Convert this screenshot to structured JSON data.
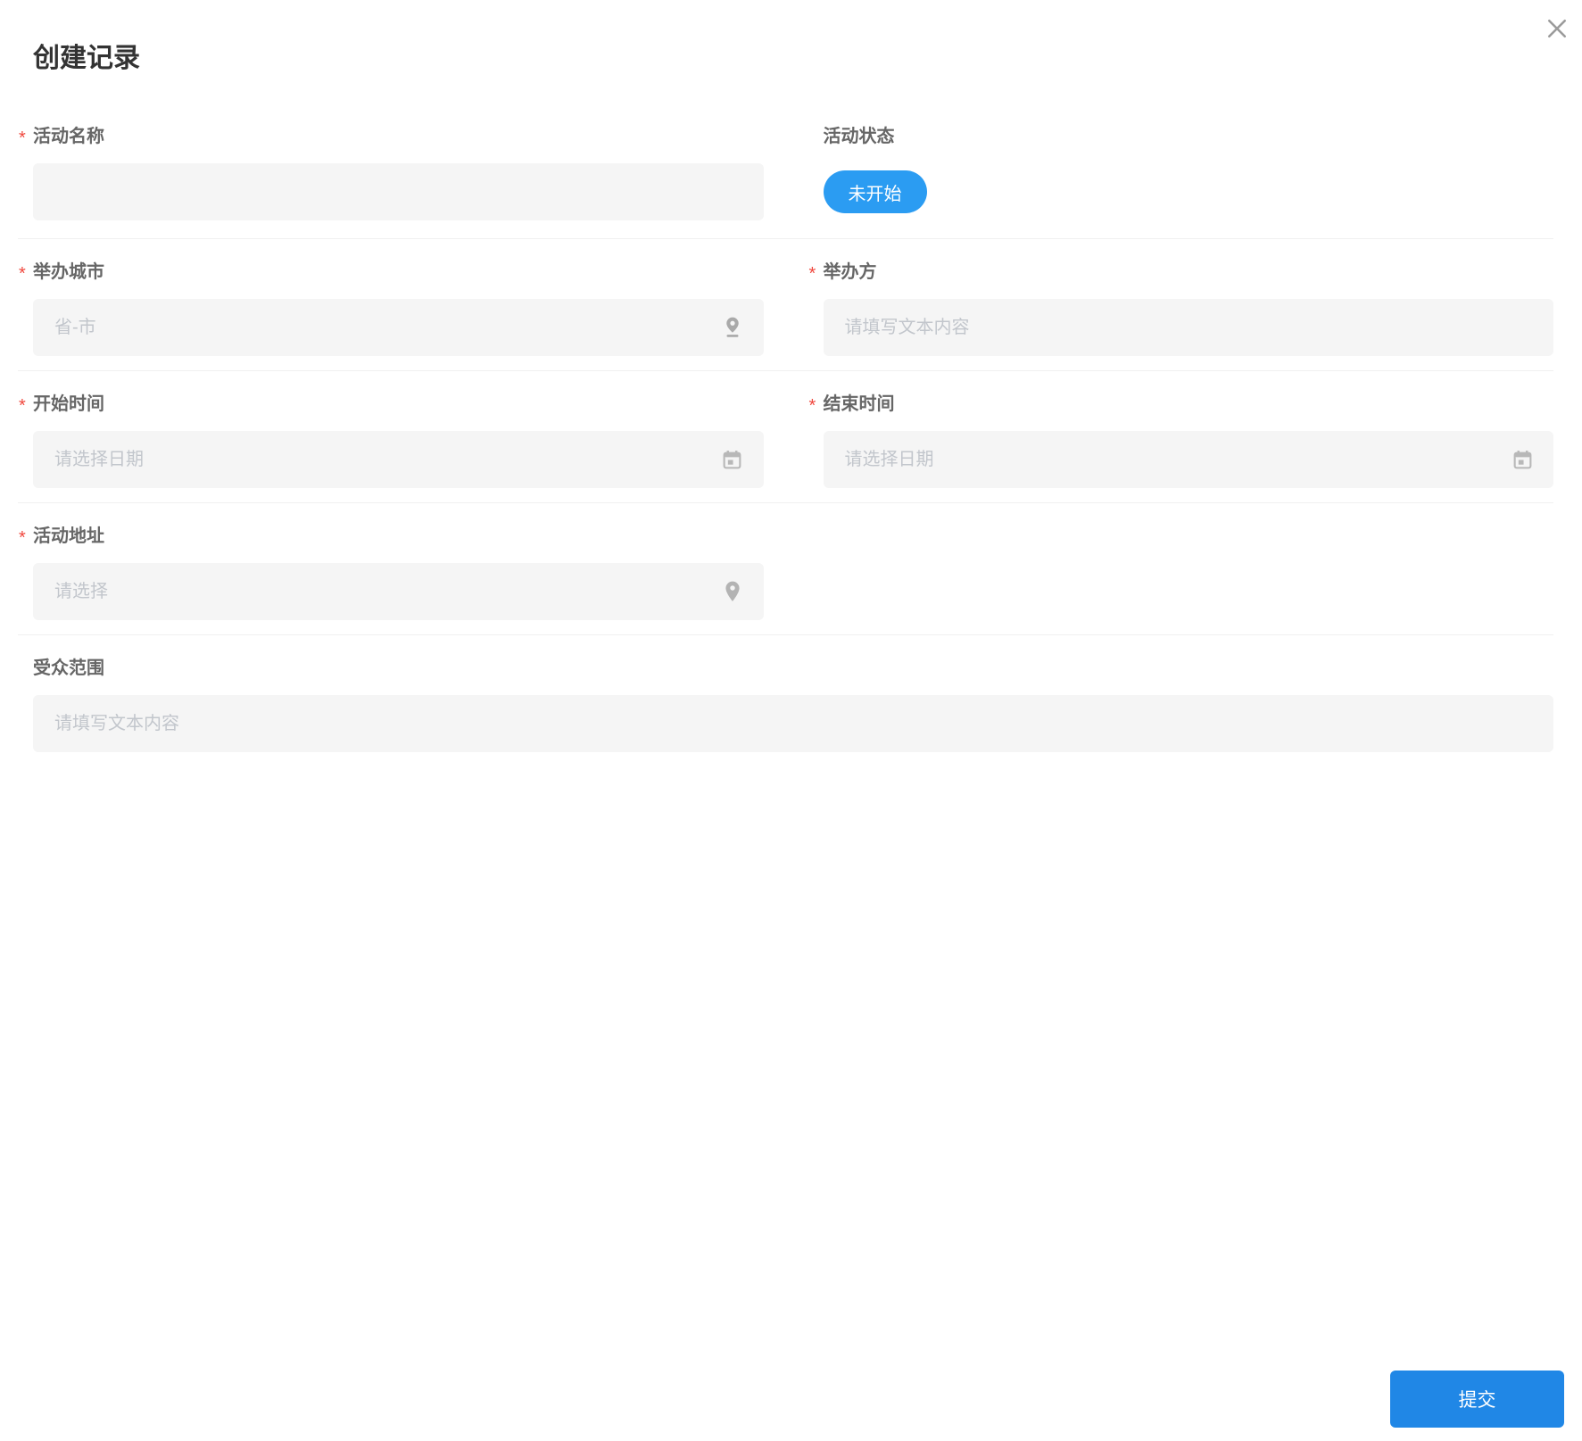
{
  "dialog": {
    "title": "创建记录",
    "required_marker": "*",
    "submit_label": "提交",
    "close_icon": "close-icon"
  },
  "fields": {
    "activity_name": {
      "label": "活动名称",
      "required": true,
      "value": ""
    },
    "activity_status": {
      "label": "活动状态",
      "required": false,
      "value": "未开始"
    },
    "host_city": {
      "label": "举办城市",
      "required": true,
      "placeholder": "省-市",
      "icon": "location-pin-underline-icon"
    },
    "organizer": {
      "label": "举办方",
      "required": true,
      "placeholder": "请填写文本内容"
    },
    "start_time": {
      "label": "开始时间",
      "required": true,
      "placeholder": "请选择日期",
      "icon": "calendar-icon"
    },
    "end_time": {
      "label": "结束时间",
      "required": true,
      "placeholder": "请选择日期",
      "icon": "calendar-icon"
    },
    "activity_address": {
      "label": "活动地址",
      "required": true,
      "placeholder": "请选择",
      "icon": "location-pin-icon"
    },
    "audience_scope": {
      "label": "受众范围",
      "required": false,
      "placeholder": "请填写文本内容"
    }
  },
  "colors": {
    "status_tag_blue": "#2b9cf2",
    "submit_button_blue": "#2087e6",
    "required_red": "#f0483e",
    "input_background": "#f5f5f5",
    "divider": "#f0f0f0",
    "label_text": "#666666",
    "placeholder_text": "#c2c6cc",
    "icon_gray": "#b0b0b0"
  }
}
